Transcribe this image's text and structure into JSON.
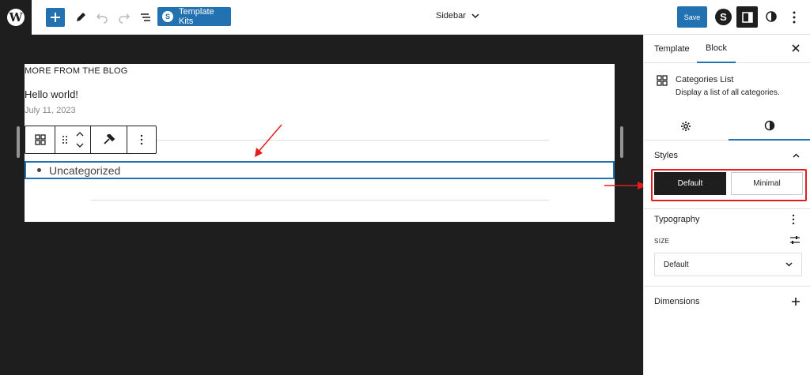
{
  "topbar": {
    "template_kits_label": "Template Kits",
    "document_title": "Sidebar",
    "save_label": "Save"
  },
  "canvas": {
    "heading": "MORE FROM THE BLOG",
    "post_title": "Hello world!",
    "post_date": "July 11, 2023",
    "category_item": "Uncategorized"
  },
  "sidebar": {
    "tabs": [
      {
        "label": "Template"
      },
      {
        "label": "Block"
      }
    ],
    "block_card": {
      "title": "Categories List",
      "description": "Display a list of all categories."
    },
    "styles": {
      "label": "Styles",
      "options": [
        {
          "label": "Default"
        },
        {
          "label": "Minimal"
        }
      ]
    },
    "typography": {
      "label": "Typography",
      "size_label": "SIZE",
      "size_value": "Default"
    },
    "dimensions": {
      "label": "Dimensions"
    }
  },
  "colors": {
    "accent": "#2271b1",
    "annotation_red": "#e11d1d",
    "dark": "#1e1e1e"
  }
}
